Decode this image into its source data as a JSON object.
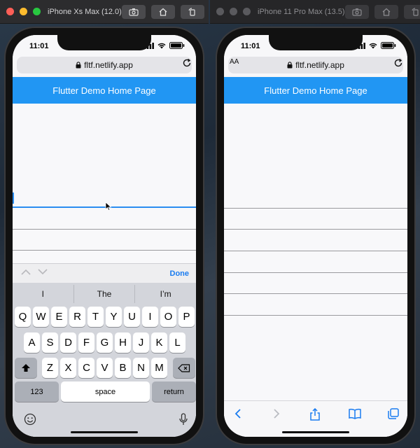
{
  "simulators": [
    {
      "title": "iPhone Xs Max (12.0)"
    },
    {
      "title": "iPhone 11 Pro Max (13.5)"
    }
  ],
  "colors": {
    "appbar": "#2196f3",
    "focus": "#2a8df0",
    "done": "#1a7cf0",
    "traffic_red": "#ff5f57",
    "traffic_yellow": "#febc2e",
    "traffic_green": "#28c840"
  },
  "left_phone": {
    "time": "11:01",
    "url": "fltf.netlify.app",
    "app_title": "Flutter Demo Home Page",
    "accessory": {
      "done_label": "Done"
    },
    "suggestions": [
      "I",
      "The",
      "I’m"
    ],
    "keyboard": {
      "row1": [
        "Q",
        "W",
        "E",
        "R",
        "T",
        "Y",
        "U",
        "I",
        "O",
        "P"
      ],
      "row2": [
        "A",
        "S",
        "D",
        "F",
        "G",
        "H",
        "J",
        "K",
        "L"
      ],
      "row3": [
        "Z",
        "X",
        "C",
        "V",
        "B",
        "N",
        "M"
      ],
      "numbers_label": "123",
      "space_label": "space",
      "return_label": "return"
    }
  },
  "right_phone": {
    "time": "11:01",
    "aa_label": "AA",
    "url": "fltf.netlify.app",
    "app_title": "Flutter Demo Home Page"
  }
}
